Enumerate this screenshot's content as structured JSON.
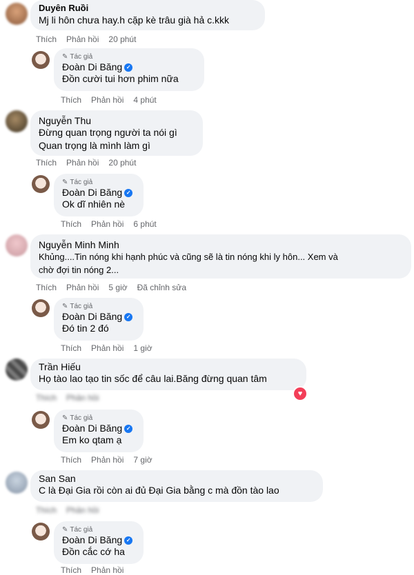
{
  "actions": {
    "like": "Thích",
    "reply": "Phản hồi",
    "edited": "Đã chỉnh sửa"
  },
  "author_badge": "Tác giả",
  "comments": [
    {
      "name": "Duyên Ruồi",
      "lines": [
        "Mj li hôn chưa hay.h cặp kè trâu già hả c.kkk"
      ],
      "time": "20 phút"
    },
    {
      "name": "Đoàn Di Băng",
      "lines": [
        "Đồn cười tui hơn phim nữa"
      ],
      "time": "4 phút"
    },
    {
      "name": "Nguyễn Thu",
      "lines": [
        "Đừng quan trọng người ta nói gì",
        "Quan trọng là mình làm gì"
      ],
      "time": "20 phút"
    },
    {
      "name": "Đoàn Di Băng",
      "lines": [
        "Ok dĩ nhiên nè"
      ],
      "time": "6 phút"
    },
    {
      "name": "Nguyễn Minh Minh",
      "lines": [
        "Khủng....Tin nóng khi hạnh phúc và cũng sẽ là tin nóng khi ly hôn... Xem và",
        "chờ đợi tin nóng 2..."
      ],
      "time": "5 giờ"
    },
    {
      "name": "Đoàn Di Băng",
      "lines": [
        "Đó tin 2 đó"
      ],
      "time": "1 giờ"
    },
    {
      "name": "Trần Hiếu",
      "lines": [
        "Họ tào lao tạo tin sốc để câu lai.Băng đừng quan tâm"
      ],
      "time": ""
    },
    {
      "name": "Đoàn Di Băng",
      "lines": [
        "Em ko qtam ạ"
      ],
      "time": "7 giờ"
    },
    {
      "name": "San San",
      "lines": [
        "C là Đại Gia rồi còn ai đủ Đại Gia bằng c mà đồn tào lao"
      ],
      "time": ""
    },
    {
      "name": "Đoàn Di Băng",
      "lines": [
        "Đồn cắc cớ ha"
      ],
      "time": ""
    }
  ],
  "colors": {
    "bubble": "#f0f2f5",
    "meta": "#65676b",
    "verified": "#1877f2",
    "heart": "#f33e58"
  }
}
